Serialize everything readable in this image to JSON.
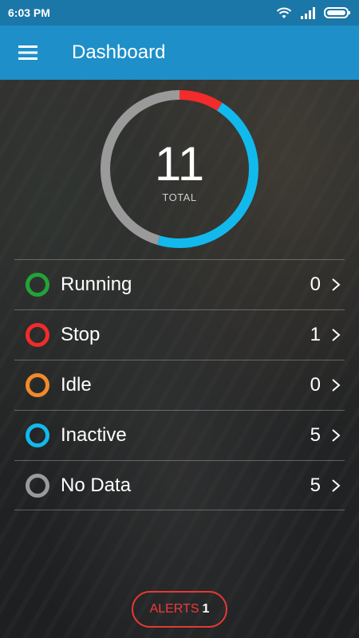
{
  "status_bar": {
    "time": "6:03 PM"
  },
  "app_bar": {
    "title": "Dashboard"
  },
  "summary": {
    "total": "11",
    "total_label": "TOTAL"
  },
  "colors": {
    "running": "#22a338",
    "stop": "#f22b2b",
    "idle": "#f2892b",
    "inactive": "#12b9ec",
    "no_data": "#9a9a9a"
  },
  "chart_data": {
    "type": "pie",
    "title": "",
    "categories": [
      "Running",
      "Stop",
      "Idle",
      "Inactive",
      "No Data"
    ],
    "values": [
      0,
      1,
      0,
      5,
      5
    ],
    "total": 11
  },
  "statuses": [
    {
      "key": "running",
      "label": "Running",
      "count": "0"
    },
    {
      "key": "stop",
      "label": "Stop",
      "count": "1"
    },
    {
      "key": "idle",
      "label": "Idle",
      "count": "0"
    },
    {
      "key": "inactive",
      "label": "Inactive",
      "count": "5"
    },
    {
      "key": "no_data",
      "label": "No Data",
      "count": "5"
    }
  ],
  "alerts": {
    "label": "ALERTS",
    "count": "1"
  }
}
